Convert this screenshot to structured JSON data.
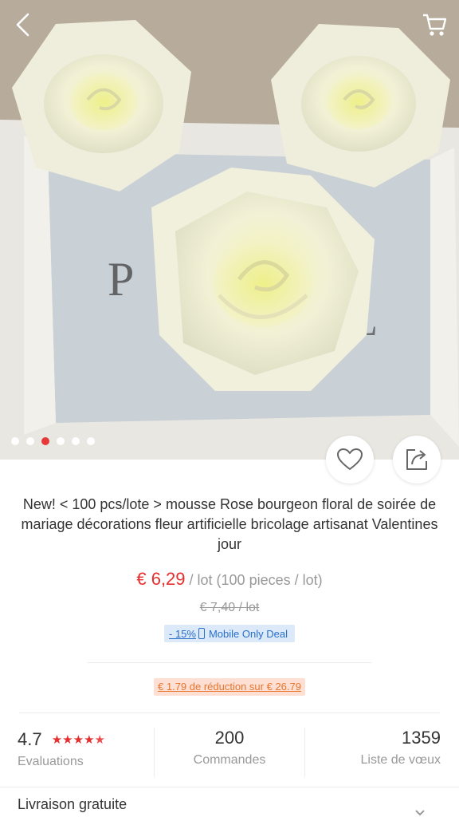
{
  "hero": {
    "photo_subject": "cream foam roses",
    "carousel": {
      "count": 6,
      "active_index": 2
    },
    "icons": {
      "back": "chevron-left-icon",
      "cart": "cart-icon",
      "wishlist": "heart-icon",
      "share": "share-icon"
    }
  },
  "product": {
    "title": "New! < 100 pcs/lote > mousse Rose bourgeon floral de soirée de mariage décorations fleur artificielle bricolage artisanat Valentines jour",
    "price": "€ 6,29",
    "unit": " / lot (100 pieces / lot)",
    "old_price": "€ 7,40  / lot",
    "discount_pct": "- 15%",
    "deal_label": "Mobile Only Deal",
    "coupon": "€ 1.79 de réduction sur € 26.79"
  },
  "stats": {
    "rating": {
      "value": "4.7",
      "label": "Evaluations",
      "stars": 4.7
    },
    "orders": {
      "value": "200",
      "label": "Commandes"
    },
    "wishlist": {
      "value": "1359",
      "label": "Liste de vœux"
    }
  },
  "shipping": {
    "label": "Livraison gratuite"
  },
  "colors": {
    "accent": "#e62e2e",
    "deal_blue": "#2a6fc9",
    "coupon_orange": "#e8742e"
  }
}
